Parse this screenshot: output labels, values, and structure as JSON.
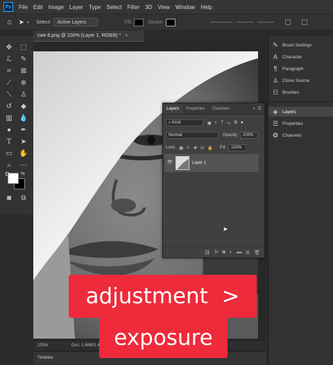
{
  "menubar": {
    "logo_text": "Ps",
    "items": [
      "File",
      "Edit",
      "Image",
      "Layer",
      "Type",
      "Select",
      "Filter",
      "3D",
      "View",
      "Window",
      "Help"
    ]
  },
  "options": {
    "select_label": "Select:",
    "select_value": "Active Layers",
    "fill_label": "Fill:",
    "stroke_label": "Stroke:"
  },
  "document": {
    "tab_title": "cwe 6.png @ 100% (Layer 1, RGB/8) *",
    "zoom": "100%",
    "doc_info": "Doc: 1.46M/1.46M"
  },
  "timeline_label": "Timeline",
  "layers_panel": {
    "tabs": [
      "Layers",
      "Properties",
      "Channels"
    ],
    "active_tab": "Layers",
    "kind_label": "Kind",
    "blend_mode": "Normal",
    "opacity_label": "Opacity:",
    "opacity_value": "100%",
    "lock_label": "Lock:",
    "fill_label": "Fill:",
    "fill_value": "100%",
    "layer_name": "Layer 1",
    "footer_icons": [
      "link-icon",
      "fx-icon",
      "mask-icon",
      "adjustment-icon",
      "group-icon",
      "new-layer-icon",
      "trash-icon"
    ]
  },
  "dock": {
    "group1": [
      "Brush Settings",
      "Character",
      "Paragraph",
      "Clone Source",
      "Brushes"
    ],
    "group2": [
      "Layers",
      "Properties",
      "Channels"
    ],
    "selected": "Layers"
  },
  "captions": {
    "line1": "adjustment  >",
    "line2": "exposure"
  },
  "colors": {
    "caption_bg": "#ee2a3b",
    "ps_blue": "#31a8ff",
    "panel_bg": "#404040"
  }
}
